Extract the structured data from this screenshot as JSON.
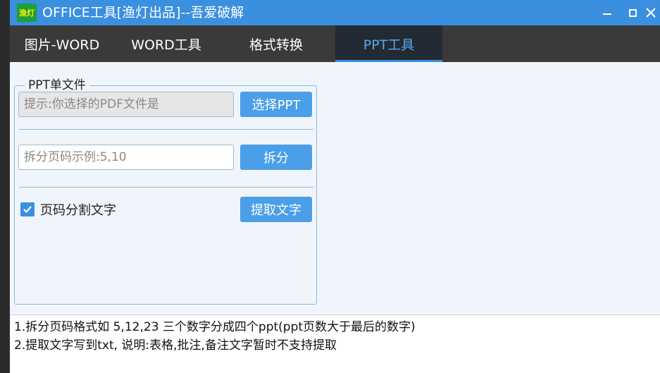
{
  "window": {
    "icon_text": "渔灯",
    "title": "OFFICE工具[渔灯出品]--吾爱破解",
    "title_color": "#3b8fdf"
  },
  "tabs": [
    {
      "label": "图片-WORD",
      "active": false
    },
    {
      "label": "WORD工具",
      "active": false
    },
    {
      "label": "格式转换",
      "active": false
    },
    {
      "label": "PPT工具",
      "active": true
    }
  ],
  "group": {
    "legend": "PPT单文件",
    "file_input": {
      "placeholder": "提示:你选择的PDF文件是",
      "value": ""
    },
    "select_button": "选择PPT",
    "split_input": {
      "placeholder": "拆分页码示例:5,10",
      "value": ""
    },
    "split_button": "拆分",
    "checkbox": {
      "label": "页码分割文字",
      "checked": true
    },
    "extract_button": "提取文字"
  },
  "notes": [
    "1.拆分页码格式如 5,12,23 三个数字分成四个ppt(ppt页数大于最后的数字)",
    "2.提取文字写到txt, 说明:表格,批注,备注文字暂时不支持提取"
  ],
  "colors": {
    "accent": "#3b8fdf",
    "button": "#4a9fe8",
    "tabbar": "#3a3a3a",
    "active_tab_text": "#5aa8f0"
  }
}
